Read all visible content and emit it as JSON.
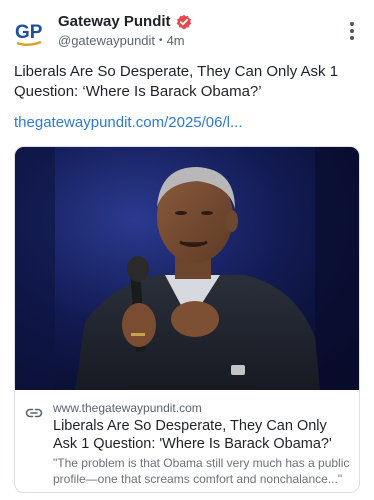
{
  "author": {
    "name": "Gateway Pundit",
    "handle": "@gatewaypundit",
    "time": "4m",
    "avatar_text": "GP",
    "verified": true
  },
  "post": {
    "text": "Liberals Are So Desperate, They Can Only Ask 1 Question: ‘Where Is Barack Obama?’",
    "link_text": "thegatewaypundit.com/2025/06/l..."
  },
  "card": {
    "domain": "www.thegatewaypundit.com",
    "title": "Liberals Are So Desperate, They Can Only Ask 1 Question: 'Where Is Barack Obama?'",
    "description": "\"The problem is that Obama still very much has a public profile—one that screams comfort and nonchalance...\""
  },
  "colors": {
    "accent": "#2d7bd6",
    "avatar_blue": "#1b4fa0",
    "avatar_gold": "#d7a22a",
    "verified": "#e6484d"
  }
}
